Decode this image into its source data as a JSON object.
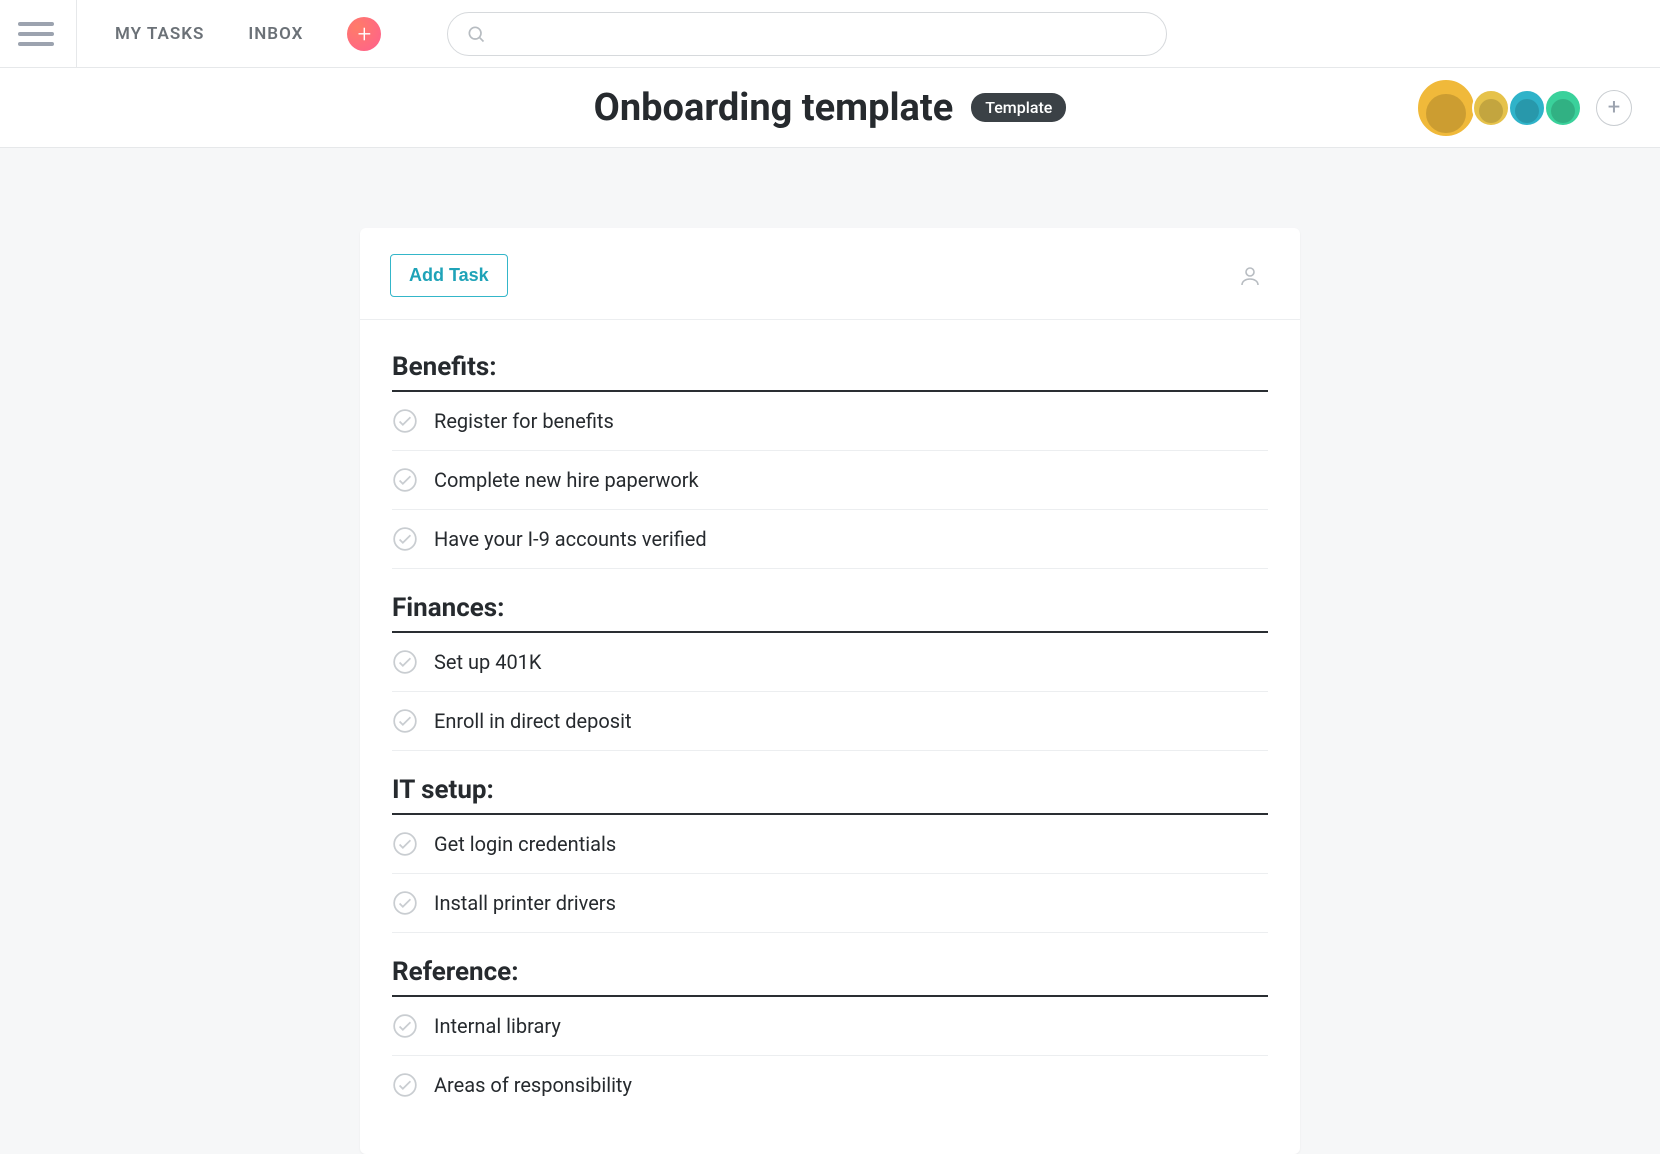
{
  "nav": {
    "my_tasks": "MY TASKS",
    "inbox": "INBOX"
  },
  "search": {
    "placeholder": ""
  },
  "header": {
    "title": "Onboarding template",
    "badge": "Template"
  },
  "members": {
    "colors": [
      "#f0b93a",
      "#e6c24a",
      "#2fb3c9",
      "#3ad19b"
    ]
  },
  "card": {
    "add_task_label": "Add Task"
  },
  "sections": [
    {
      "title": "Benefits:",
      "tasks": [
        "Register for benefits",
        "Complete new hire paperwork",
        "Have your I-9 accounts verified"
      ]
    },
    {
      "title": "Finances:",
      "tasks": [
        "Set up 401K",
        "Enroll in direct deposit"
      ]
    },
    {
      "title": "IT setup:",
      "tasks": [
        "Get login credentials",
        "Install printer drivers"
      ]
    },
    {
      "title": "Reference:",
      "tasks": [
        "Internal library",
        "Areas of responsibility"
      ]
    }
  ]
}
